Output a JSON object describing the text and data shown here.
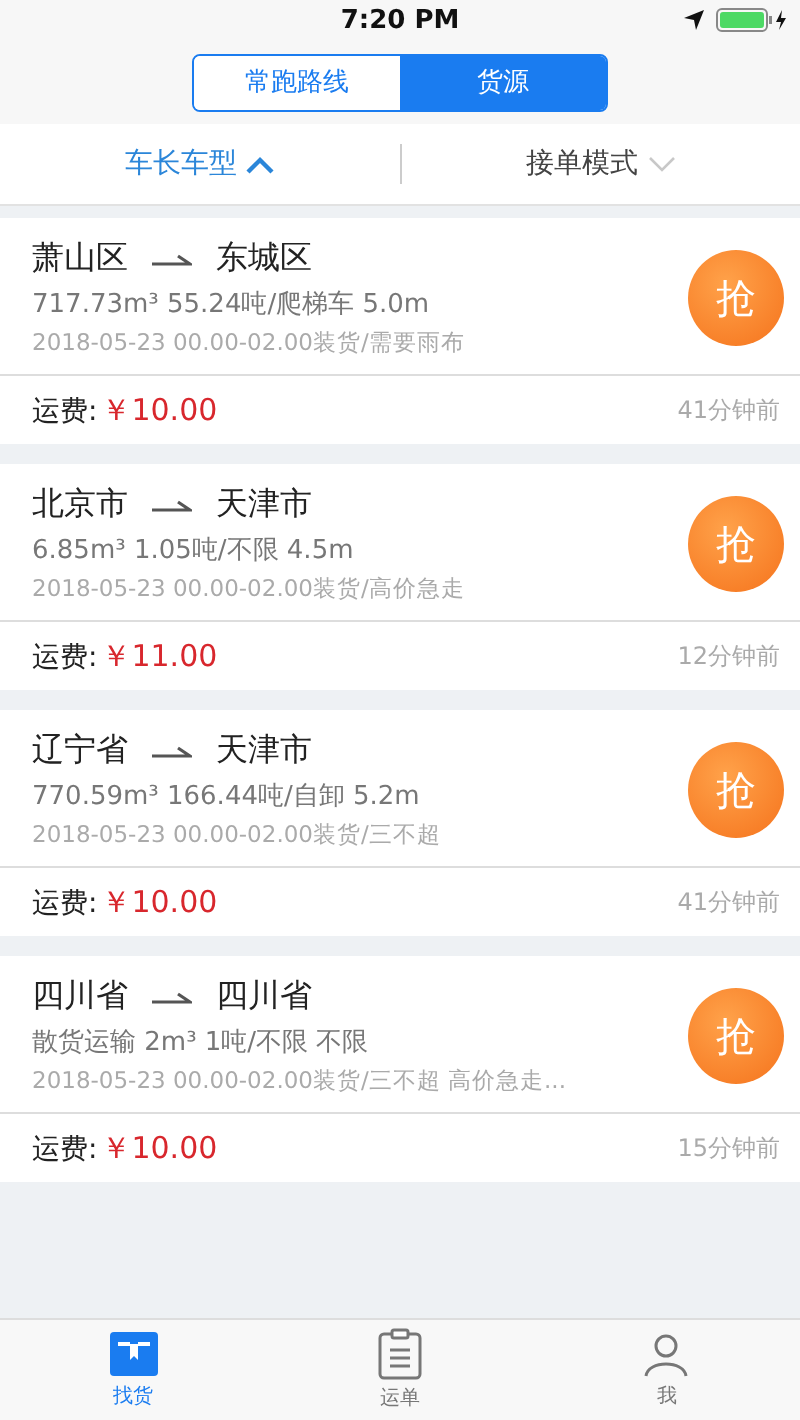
{
  "status_bar": {
    "time": "7:20 PM"
  },
  "segments": [
    {
      "label": "常跑路线",
      "selected": false
    },
    {
      "label": "货源",
      "selected": true
    }
  ],
  "filters": [
    {
      "label": "车长车型",
      "expanded": true
    },
    {
      "label": "接单模式",
      "expanded": false
    }
  ],
  "orders": [
    {
      "from": "萧山区",
      "to": "东城区",
      "specs": "717.73m³ 55.24吨/爬梯车 5.0m",
      "details": "2018-05-23 00.00-02.00装货/需要雨布",
      "grab": "抢",
      "fee_label": "运费:",
      "fee": "￥10.00",
      "time": "41分钟前"
    },
    {
      "from": "北京市",
      "to": "天津市",
      "specs": "6.85m³ 1.05吨/不限 4.5m",
      "details": "2018-05-23 00.00-02.00装货/高价急走",
      "grab": "抢",
      "fee_label": "运费:",
      "fee": "￥11.00",
      "time": "12分钟前"
    },
    {
      "from": "辽宁省",
      "to": "天津市",
      "specs": "770.59m³ 166.44吨/自卸 5.2m",
      "details": "2018-05-23 00.00-02.00装货/三不超",
      "grab": "抢",
      "fee_label": "运费:",
      "fee": "￥10.00",
      "time": "41分钟前"
    },
    {
      "from": "四川省",
      "to": "四川省",
      "specs": "散货运输 2m³ 1吨/不限 不限",
      "details": "2018-05-23 00.00-02.00装货/三不超 高价急走...",
      "grab": "抢",
      "fee_label": "运费:",
      "fee": "￥10.00",
      "time": "15分钟前"
    }
  ],
  "tab_bar": [
    {
      "label": "找货",
      "kind": "cargo",
      "selected": true
    },
    {
      "label": "运单",
      "kind": "waybill",
      "selected": false
    },
    {
      "label": "我",
      "kind": "me",
      "selected": false
    }
  ]
}
